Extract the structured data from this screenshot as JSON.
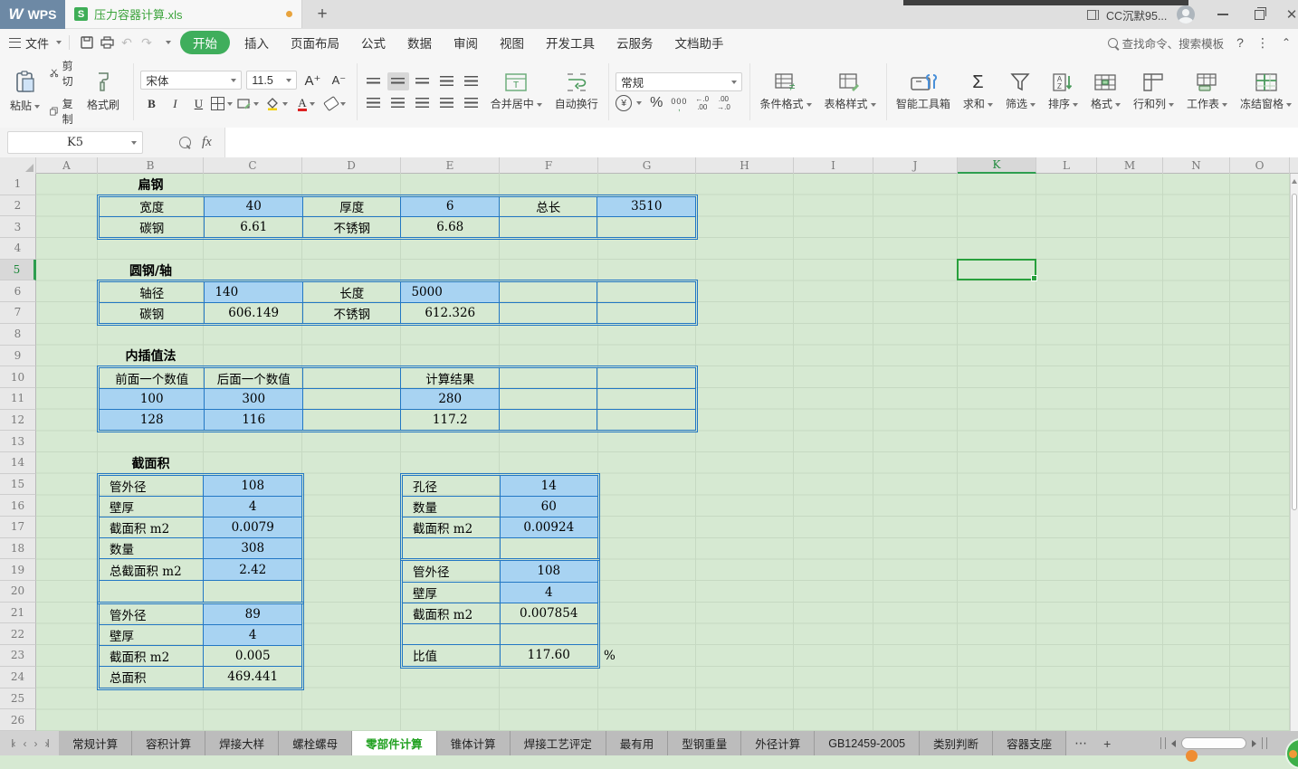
{
  "title_bar": {
    "app_name": "WPS",
    "document_tab": "压力容器计算.xls",
    "new_tab_button": "+",
    "user_name": "CC沉默95..."
  },
  "menu_bar": {
    "file_menu": "文件",
    "tabs": [
      "开始",
      "插入",
      "页面布局",
      "公式",
      "数据",
      "审阅",
      "视图",
      "开发工具",
      "云服务",
      "文档助手"
    ],
    "active_tab": "开始",
    "search_text": "查找命令、搜索模板",
    "help": "?"
  },
  "ribbon": {
    "paste": "粘贴",
    "cut": "剪切",
    "copy": "复制",
    "format_painter": "格式刷",
    "font_name": "宋体",
    "font_size": "11.5",
    "font_bigger": "A⁺",
    "font_smaller": "A⁻",
    "bold": "B",
    "italic": "I",
    "underline": "U",
    "merge_center": "合并居中",
    "wrap_text": "自动换行",
    "number_format": "常规",
    "currency": "¥",
    "percent": "%",
    "thousands": "000",
    "inc_decimal": "←.0\n.00",
    "dec_decimal": ".00\n→.0",
    "conditional_format": "条件格式",
    "table_style": "表格样式",
    "smart_toolbox": "智能工具箱",
    "sum": "求和",
    "filter": "筛选",
    "sort": "排序",
    "format": "格式",
    "rows_cols": "行和列",
    "worksheet": "工作表",
    "freeze_panes": "冻结窗格"
  },
  "formula_bar": {
    "name_box": "K5",
    "fx": "fx",
    "formula_value": ""
  },
  "sheet": {
    "columns": [
      "A",
      "B",
      "C",
      "D",
      "E",
      "F",
      "G",
      "H",
      "I",
      "J",
      "K",
      "L",
      "M",
      "N",
      "O"
    ],
    "selected_column": "K",
    "row_numbers": [
      "1",
      "2",
      "3",
      "4",
      "5",
      "6",
      "7",
      "8",
      "9",
      "10",
      "11",
      "12",
      "13",
      "14",
      "15",
      "16",
      "17",
      "18",
      "19",
      "20",
      "21",
      "22",
      "23",
      "24",
      "25",
      "26"
    ],
    "selected_row": "5",
    "selected_cell": "K5",
    "section_titles": [
      "扁钢",
      "圆钢/轴",
      "内插值法",
      "截面积"
    ],
    "percent_suffix": "%",
    "tables": {
      "flat_steel": {
        "rows": [
          [
            {
              "v": "宽度"
            },
            {
              "v": "40",
              "bg": "b"
            },
            {
              "v": "厚度"
            },
            {
              "v": "6",
              "bg": "b"
            },
            {
              "v": "总长"
            },
            {
              "v": "3510",
              "bg": "b"
            }
          ],
          [
            {
              "v": "碳钢"
            },
            {
              "v": "6.61"
            },
            {
              "v": "不锈钢"
            },
            {
              "v": "6.68"
            },
            {
              "v": ""
            },
            {
              "v": ""
            }
          ]
        ]
      },
      "round_steel": {
        "rows": [
          [
            {
              "v": "轴径"
            },
            {
              "v": "140",
              "bg": "b",
              "al": "l"
            },
            {
              "v": "长度"
            },
            {
              "v": "5000",
              "bg": "b",
              "al": "l"
            },
            {
              "v": ""
            },
            {
              "v": ""
            }
          ],
          [
            {
              "v": "碳钢"
            },
            {
              "v": "606.149"
            },
            {
              "v": "不锈钢"
            },
            {
              "v": "612.326"
            },
            {
              "v": ""
            },
            {
              "v": ""
            }
          ]
        ]
      },
      "interpolation": {
        "rows": [
          [
            {
              "v": "前面一个数值"
            },
            {
              "v": "后面一个数值"
            },
            {
              "v": ""
            },
            {
              "v": "计算结果"
            },
            {
              "v": ""
            },
            {
              "v": ""
            }
          ],
          [
            {
              "v": "100",
              "bg": "b"
            },
            {
              "v": "300",
              "bg": "b"
            },
            {
              "v": ""
            },
            {
              "v": "280",
              "bg": "b"
            },
            {
              "v": ""
            },
            {
              "v": ""
            }
          ],
          [
            {
              "v": "128",
              "bg": "b"
            },
            {
              "v": "116",
              "bg": "b"
            },
            {
              "v": ""
            },
            {
              "v": "117.2"
            },
            {
              "v": ""
            },
            {
              "v": ""
            }
          ]
        ]
      },
      "cross_section_left_top": {
        "rows": [
          [
            {
              "v": "管外径",
              "al": "l"
            },
            {
              "v": "108",
              "bg": "b"
            }
          ],
          [
            {
              "v": "壁厚",
              "al": "l"
            },
            {
              "v": "4",
              "bg": "b"
            }
          ],
          [
            {
              "v": "截面积 m2",
              "al": "l"
            },
            {
              "v": "0.0079",
              "bg": "b"
            }
          ],
          [
            {
              "v": "数量",
              "al": "l"
            },
            {
              "v": "308",
              "bg": "b"
            }
          ],
          [
            {
              "v": "总截面积 m2",
              "al": "l"
            },
            {
              "v": "2.42",
              "bg": "b"
            }
          ],
          [
            {
              "v": ""
            },
            {
              "v": ""
            }
          ]
        ]
      },
      "cross_section_left_bottom": {
        "rows": [
          [
            {
              "v": "管外径",
              "al": "l"
            },
            {
              "v": "89",
              "bg": "b"
            }
          ],
          [
            {
              "v": "壁厚",
              "al": "l"
            },
            {
              "v": "4",
              "bg": "b"
            }
          ],
          [
            {
              "v": "截面积 m2",
              "al": "l"
            },
            {
              "v": "0.005"
            }
          ],
          [
            {
              "v": "总面积",
              "al": "l"
            },
            {
              "v": "469.441"
            }
          ]
        ]
      },
      "cross_section_right_top": {
        "rows": [
          [
            {
              "v": "孔径",
              "al": "l"
            },
            {
              "v": "14",
              "bg": "b"
            }
          ],
          [
            {
              "v": "数量",
              "al": "l"
            },
            {
              "v": "60",
              "bg": "b"
            }
          ],
          [
            {
              "v": "截面积 m2",
              "al": "l"
            },
            {
              "v": "0.00924",
              "bg": "b"
            }
          ],
          [
            {
              "v": ""
            },
            {
              "v": ""
            }
          ]
        ]
      },
      "cross_section_right_bottom": {
        "rows": [
          [
            {
              "v": "管外径",
              "al": "l"
            },
            {
              "v": "108",
              "bg": "b"
            }
          ],
          [
            {
              "v": "壁厚",
              "al": "l"
            },
            {
              "v": "4",
              "bg": "b"
            }
          ],
          [
            {
              "v": "截面积 m2",
              "al": "l"
            },
            {
              "v": "0.007854"
            }
          ],
          [
            {
              "v": ""
            },
            {
              "v": ""
            }
          ],
          [
            {
              "v": "比值",
              "al": "l"
            },
            {
              "v": "117.60"
            }
          ]
        ]
      }
    }
  },
  "sheet_tab_bar": {
    "tabs": [
      "常规计算",
      "容积计算",
      "焊接大样",
      "螺栓螺母",
      "零部件计算",
      "锥体计算",
      "焊接工艺评定",
      "最有用",
      "型钢重量",
      "外径计算",
      "GB12459-2005",
      "类别判断",
      "容器支座"
    ],
    "active_tab": "零部件计算",
    "more_button": "⋯",
    "add_sheet_button": "+"
  }
}
